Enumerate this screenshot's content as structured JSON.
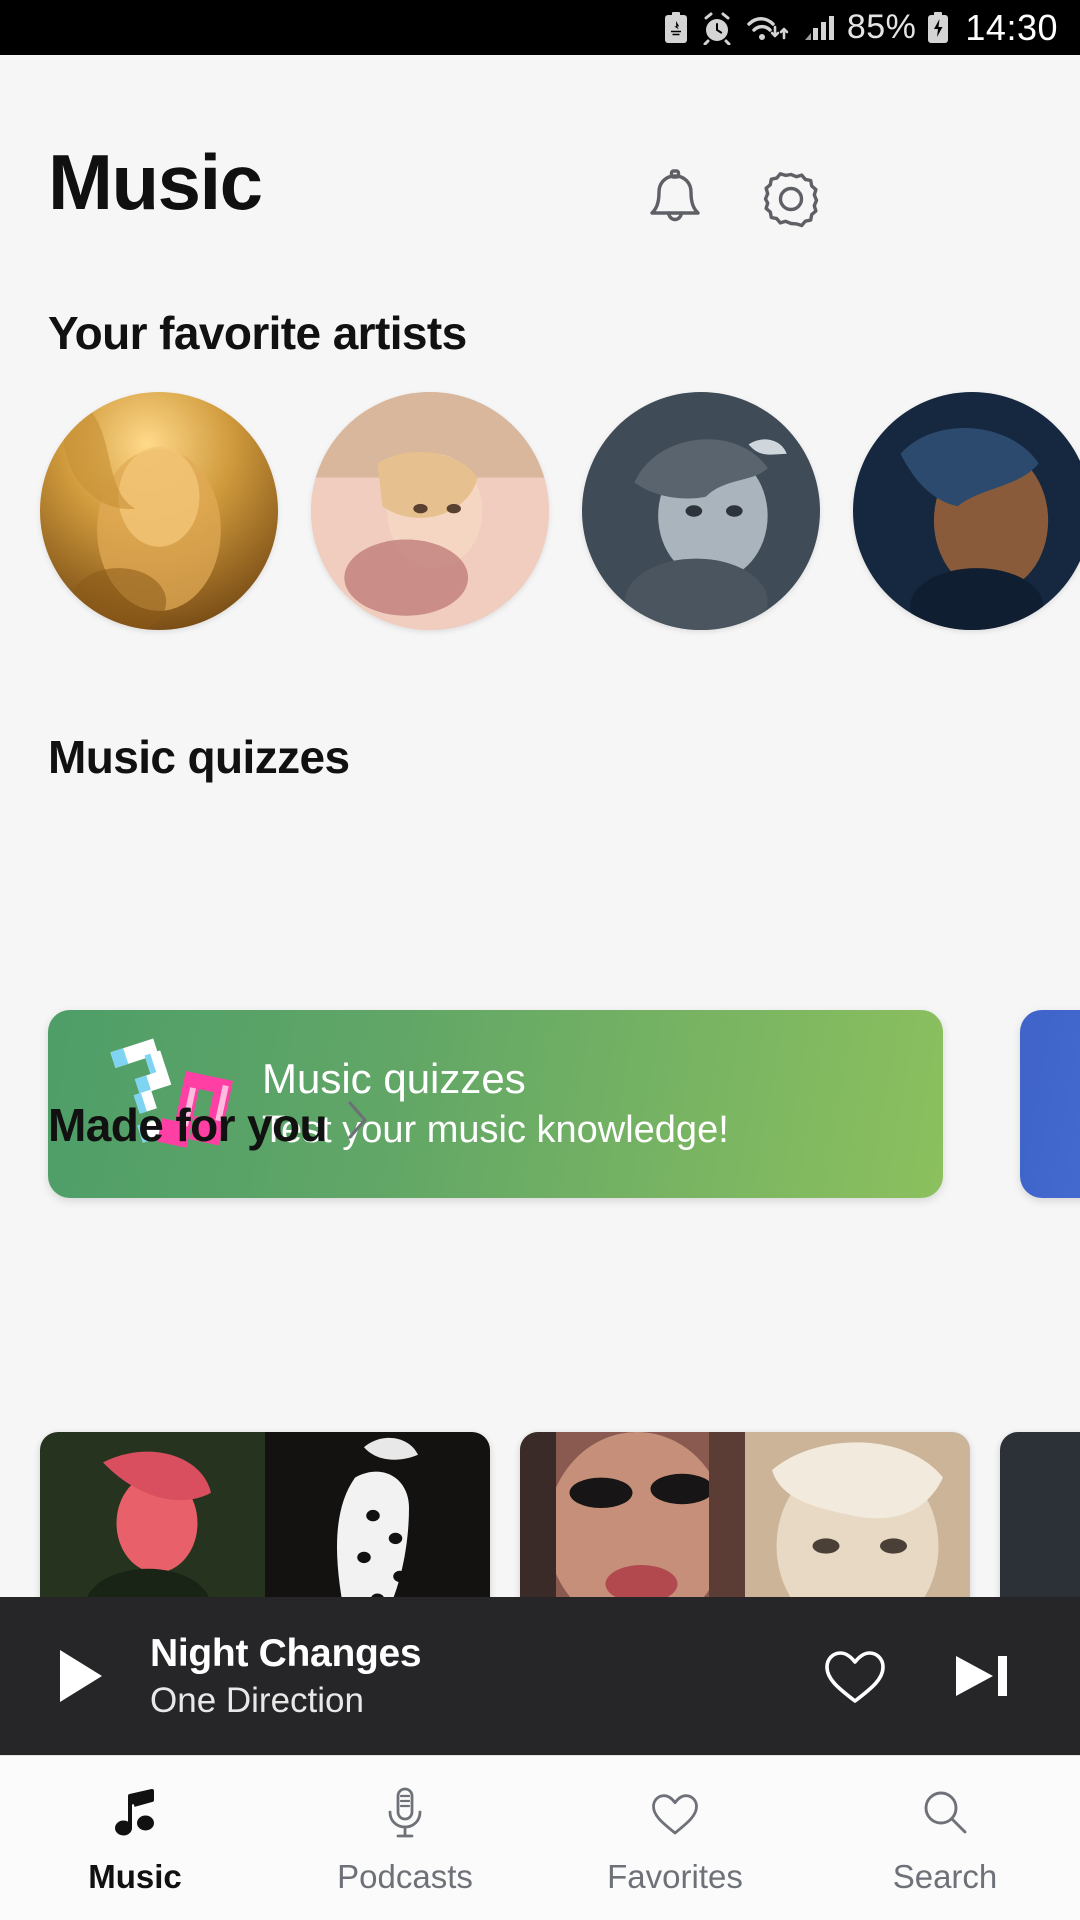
{
  "statusbar": {
    "battery_percent": "85%",
    "time": "14:30",
    "icons": [
      "battery-saver-icon",
      "alarm-icon",
      "wifi-icon",
      "cellular-signal-icon",
      "charging-battery-icon"
    ]
  },
  "header": {
    "title": "Music",
    "notifications_icon": "bell-icon",
    "settings_icon": "gear-icon"
  },
  "sections": {
    "favorite_artists": {
      "title": "Your favorite artists",
      "artists": [
        {
          "name": "artist-1",
          "tone_a": "#c98a2e",
          "tone_b": "#f2c469",
          "tone_c": "#7a4c12"
        },
        {
          "name": "artist-2",
          "tone_a": "#d8a98f",
          "tone_b": "#f0cbb4",
          "tone_c": "#9c6f58"
        },
        {
          "name": "artist-3",
          "tone_a": "#4c5964",
          "tone_b": "#8b98a3",
          "tone_c": "#2a3239"
        },
        {
          "name": "artist-4",
          "tone_a": "#1c3050",
          "tone_b": "#35506f",
          "tone_c": "#0d1a2c"
        }
      ]
    },
    "music_quizzes": {
      "title": "Music quizzes",
      "cards": [
        {
          "title": "Music quizzes",
          "subtitle": "Test your music knowledge!",
          "color_start": "#4e9e68",
          "color_end": "#8cc05e",
          "icon": "pixel-question-music-note-icon"
        },
        {
          "title": "",
          "subtitle": "",
          "color_start": "#3f63c8",
          "color_end": "#4f79e0",
          "icon": "pixel-question-icon"
        }
      ]
    },
    "made_for_you": {
      "title": "Made for you",
      "chevron_icon": "chevron-right-icon",
      "cards": [
        {
          "name": "mix-card-1",
          "left_tone": "#2a3a24",
          "right_tone": "#17150f"
        },
        {
          "name": "mix-card-2",
          "left_tone": "#6b3f3a",
          "right_tone": "#c6a98c"
        },
        {
          "name": "mix-card-3",
          "left_tone": "#2c3138",
          "right_tone": "#3a4048"
        }
      ]
    }
  },
  "player": {
    "play_icon": "play-icon",
    "track_title": "Night Changes",
    "track_artist": "One Direction",
    "favorite_icon": "heart-outline-icon",
    "next_icon": "skip-next-icon",
    "background": "#262629"
  },
  "bottom_nav": {
    "items": [
      {
        "label": "Music",
        "icon": "music-note-icon",
        "active": true
      },
      {
        "label": "Podcasts",
        "icon": "microphone-icon",
        "active": false
      },
      {
        "label": "Favorites",
        "icon": "heart-outline-icon",
        "active": false
      },
      {
        "label": "Search",
        "icon": "search-icon",
        "active": false
      }
    ]
  }
}
